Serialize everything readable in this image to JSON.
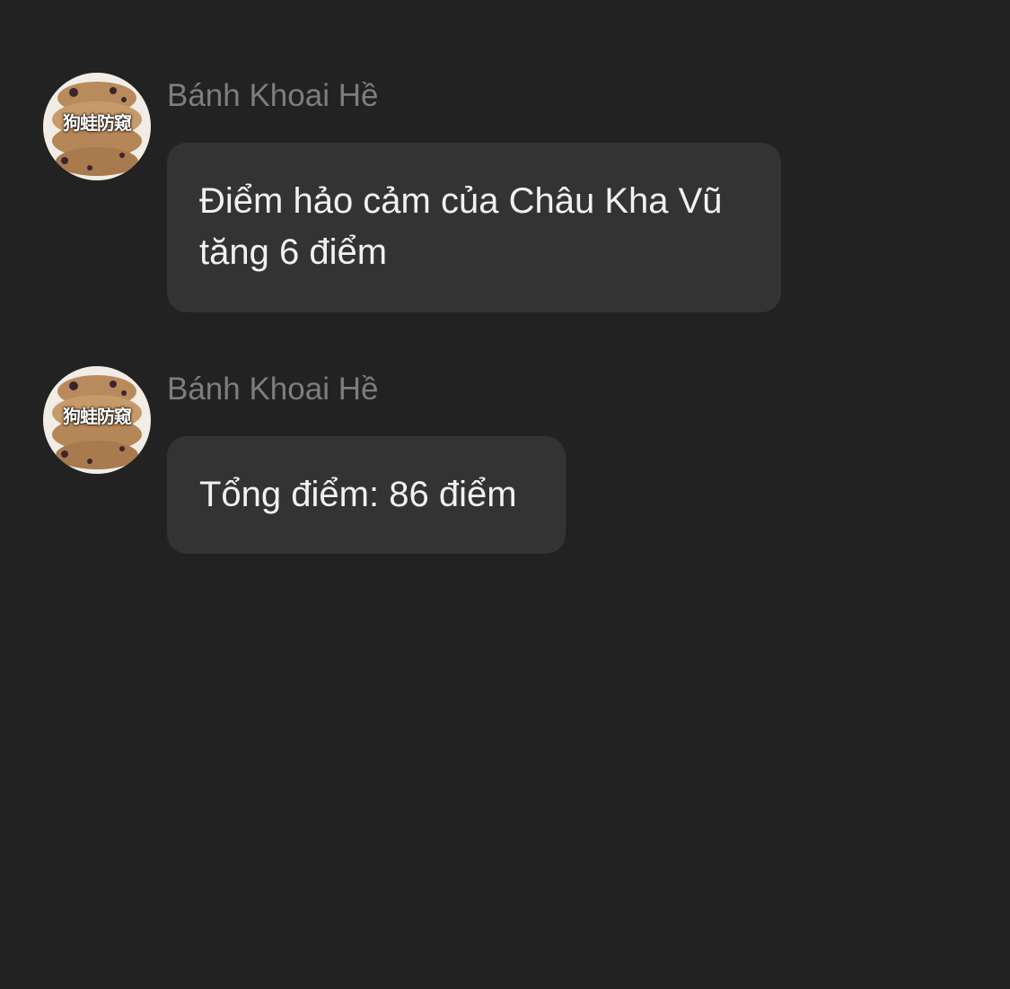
{
  "messages": [
    {
      "sender": "Bánh Khoai Hề",
      "avatar_caption": "狗蛙防窥",
      "lines": [
        "Điểm hảo cảm của Châu Kha Vũ",
        "tăng 6 điểm"
      ]
    },
    {
      "sender": "Bánh Khoai Hề",
      "avatar_caption": "狗蛙防窥",
      "lines": [
        "Tổng điểm: 86 điểm"
      ]
    }
  ]
}
